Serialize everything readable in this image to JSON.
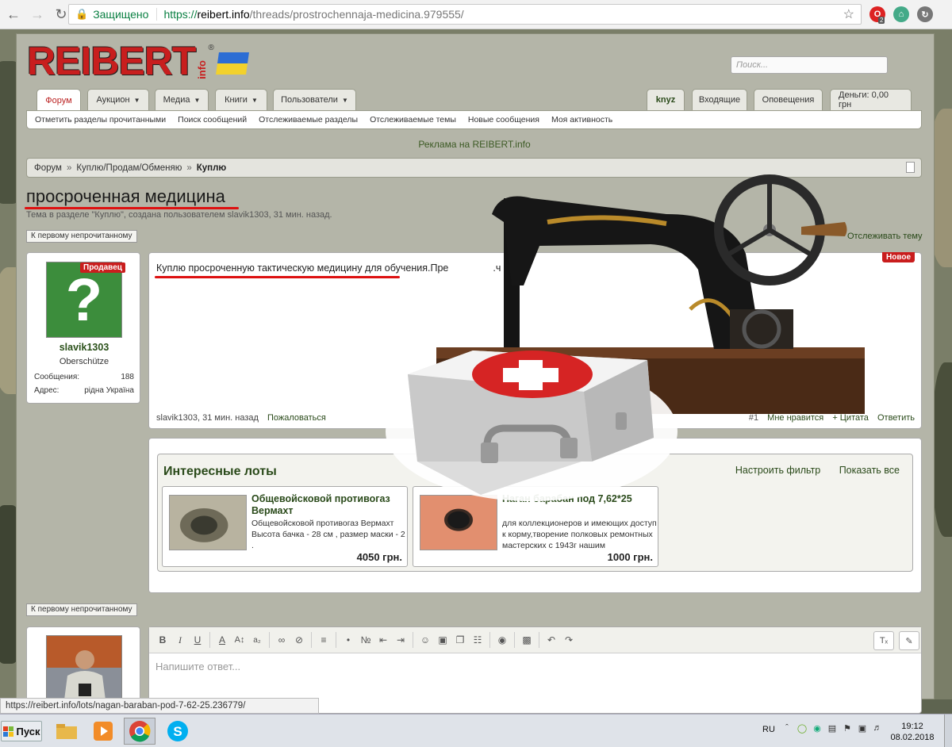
{
  "browser": {
    "secure_label": "Защищено",
    "url_scheme": "https://",
    "url_host": "reibert.info",
    "url_path": "/threads/prostrochennaja-medicina.979555/",
    "ext_badge": "2"
  },
  "site": {
    "logo_text": "REIBERT",
    "logo_info": "info",
    "logo_reg": "®",
    "search_placeholder": "Поиск..."
  },
  "tabs": [
    {
      "label": "Форум"
    },
    {
      "label": "Аукцион"
    },
    {
      "label": "Медиа"
    },
    {
      "label": "Книги"
    },
    {
      "label": "Пользователи"
    }
  ],
  "user_tabs": [
    {
      "label": "knyz"
    },
    {
      "label": "Входящие"
    },
    {
      "label": "Оповещения"
    },
    {
      "label": "Деньги: 0,00 грн"
    }
  ],
  "subnav": [
    "Отметить разделы прочитанными",
    "Поиск сообщений",
    "Отслеживаемые разделы",
    "Отслеживаемые темы",
    "Новые сообщения",
    "Моя активность"
  ],
  "ad_text": "Реклама на REIBERT.info",
  "breadcrumb": {
    "items": [
      "Форум",
      "Куплю/Продам/Обменяю"
    ],
    "current": "Куплю",
    "sep": "»"
  },
  "thread": {
    "title": "просроченная медицина",
    "subtitle": "Тема в разделе \"Куплю\", создана пользователем slavik1303, 31 мин. назад.",
    "first_unread": "К первому непрочитанному",
    "watch": "Отслеживать тему"
  },
  "post": {
    "author": "slavik1303",
    "rank": "Oberschütze",
    "seller_badge": "Продавец",
    "messages_label": "Сообщения:",
    "messages_value": "188",
    "address_label": "Адрес:",
    "address_value": "рідна Україна",
    "new_badge": "Новое",
    "text_visible_start": "Куплю просроченную тактическую медицину для обучения.Пре",
    "text_visible_end": ".ч в л.с",
    "footer_meta": "slavik1303, 31 мин. назад",
    "report": "Пожаловаться",
    "number": "#1",
    "like": "Мне нравится",
    "quote": "+ Цитата",
    "reply": "Ответить"
  },
  "lots": {
    "heading": "Интересные лоты",
    "filter": "Настроить фильтр",
    "show_all": "Показать все",
    "items": [
      {
        "title": "Общевойсковой противогаз Вермахт",
        "desc": "Общевойсковой противогаз Вермахт Высота бачка - 28 см , размер маски - 2 .",
        "price": "4050 грн."
      },
      {
        "title": "Наган барабан под 7,62*25",
        "desc": "для коллекционеров и имеющих доступ к корму,творение полковых ремонтных мастерских с 1943г нашим",
        "price": "1000 грн."
      }
    ]
  },
  "reply": {
    "placeholder": "Напишите ответ..."
  },
  "status_url": "https://reibert.info/lots/nagan-baraban-pod-7-62-25.236779/",
  "taskbar": {
    "start": "Пуск",
    "lang": "RU",
    "time": "19:12",
    "date": "08.02.2018"
  },
  "colors": {
    "accent_red": "#c91d1d",
    "link_green": "#2a4a1a",
    "secure_green": "#0b8043"
  },
  "icons": [
    "back-icon",
    "forward-icon",
    "reload-icon",
    "lock-icon",
    "star-icon",
    "bold-icon",
    "italic-icon",
    "underline-icon",
    "smile-icon",
    "image-icon",
    "undo-icon",
    "redo-icon",
    "chrome-icon",
    "skype-icon"
  ]
}
